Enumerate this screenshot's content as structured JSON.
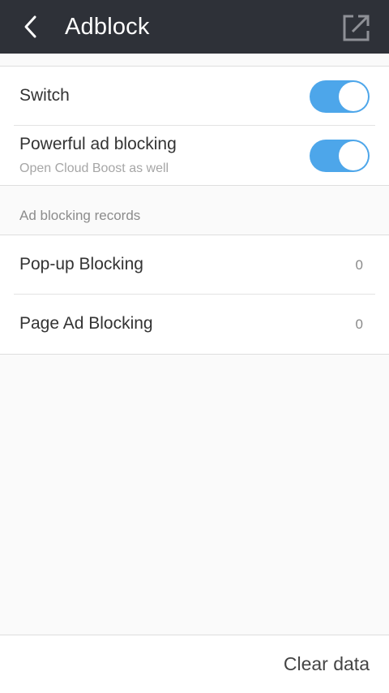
{
  "header": {
    "title": "Adblock",
    "back_icon": "chevron-left-icon",
    "share_icon": "external-link-icon",
    "background": "#2e3138"
  },
  "settings": {
    "switch": {
      "label": "Switch",
      "enabled": true
    },
    "powerful": {
      "label": "Powerful ad blocking",
      "sublabel": "Open Cloud Boost as well",
      "enabled": true
    },
    "toggle_color": "#4da6ea"
  },
  "records": {
    "section_label": "Ad blocking records",
    "items": [
      {
        "label": "Pop-up Blocking",
        "count": "0"
      },
      {
        "label": "Page Ad Blocking",
        "count": "0"
      }
    ]
  },
  "footer": {
    "clear_label": "Clear data"
  }
}
